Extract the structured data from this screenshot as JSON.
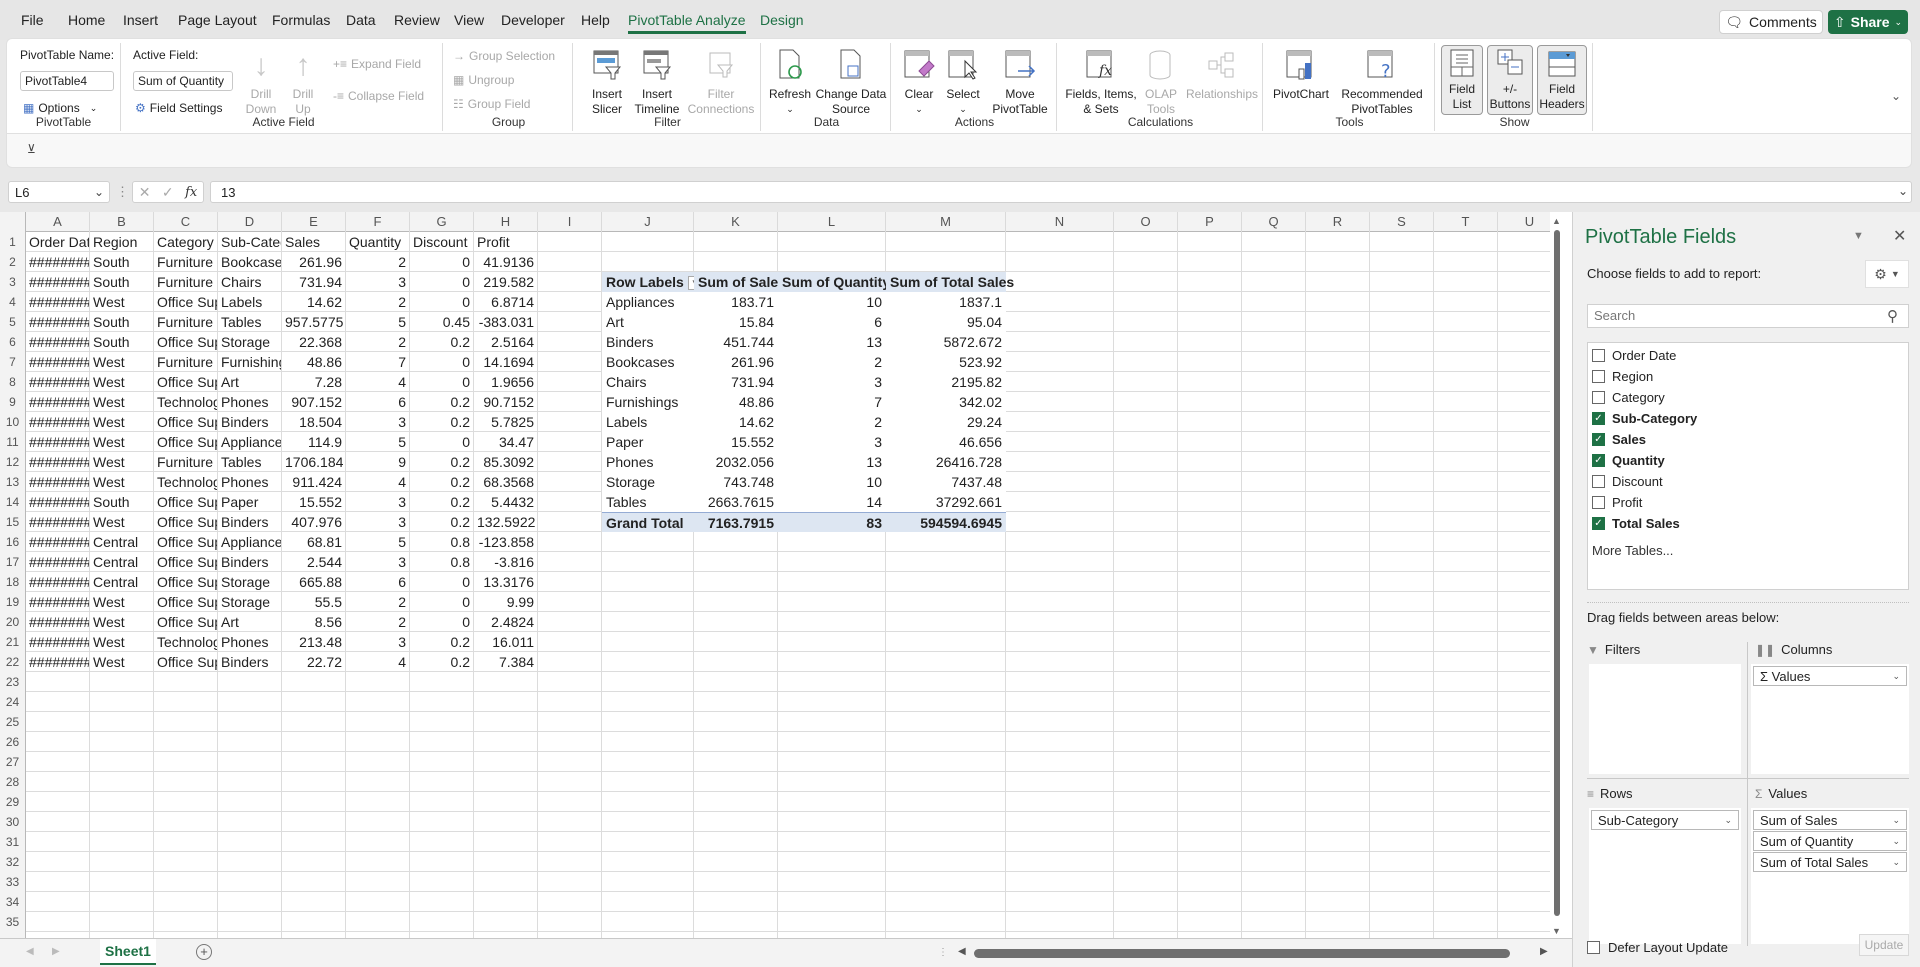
{
  "menu": {
    "items": [
      "File",
      "Home",
      "Insert",
      "Page Layout",
      "Formulas",
      "Data",
      "Review",
      "View",
      "Developer",
      "Help",
      "PivotTable Analyze",
      "Design"
    ],
    "active": "PivotTable Analyze",
    "comments_label": "Comments",
    "share_label": "Share"
  },
  "ribbon": {
    "pivottable": {
      "name_label": "PivotTable Name:",
      "name_value": "PivotTable4",
      "options_label": "Options",
      "group_label": "PivotTable"
    },
    "active_field": {
      "label": "Active Field:",
      "value": "Sum of Quantity",
      "field_settings": "Field Settings",
      "drill_down": "Drill Down",
      "drill_up": "Drill Up",
      "expand_field": "Expand Field",
      "collapse_field": "Collapse Field",
      "group_label": "Active Field"
    },
    "group": {
      "group_selection": "Group Selection",
      "ungroup": "Ungroup",
      "group_field": "Group Field",
      "group_label": "Group"
    },
    "filter": {
      "insert_slicer": "Insert Slicer",
      "insert_timeline": "Insert Timeline",
      "filter_connections": "Filter Connections",
      "group_label": "Filter"
    },
    "data": {
      "refresh": "Refresh",
      "change_data_source": "Change Data Source",
      "group_label": "Data"
    },
    "actions": {
      "clear": "Clear",
      "select": "Select",
      "move_pivottable": "Move PivotTable",
      "group_label": "Actions"
    },
    "calculations": {
      "fields_items_sets": "Fields, Items, & Sets",
      "olap_tools": "OLAP Tools",
      "relationships": "Relationships",
      "group_label": "Calculations"
    },
    "tools": {
      "pivotchart": "PivotChart",
      "recommended": "Recommended PivotTables",
      "group_label": "Tools"
    },
    "show": {
      "field_list": "Field List",
      "buttons": "+/- Buttons",
      "field_headers": "Field Headers",
      "group_label": "Show"
    }
  },
  "formula_bar": {
    "name_box": "L6",
    "formula": "13"
  },
  "sheet": {
    "columns": [
      "A",
      "B",
      "C",
      "D",
      "E",
      "F",
      "G",
      "H",
      "I",
      "J",
      "K",
      "L",
      "M",
      "N",
      "O",
      "P",
      "Q",
      "R",
      "S",
      "T",
      "U"
    ],
    "row_numbers": [
      1,
      2,
      3,
      4,
      5,
      6,
      7,
      8,
      9,
      10,
      11,
      12,
      13,
      14,
      15,
      16,
      17,
      18,
      19,
      20,
      21,
      22,
      23,
      24,
      25,
      26,
      27,
      28,
      29,
      30,
      31,
      32,
      33,
      34,
      35
    ],
    "headers": [
      "Order Dat",
      "Region",
      "Category",
      "Sub-Categ",
      "Sales",
      "Quantity",
      "Discount",
      "Profit"
    ],
    "rows": [
      [
        "########",
        "South",
        "Furniture",
        "Bookcases",
        "261.96",
        "2",
        "0",
        "41.9136"
      ],
      [
        "########",
        "South",
        "Furniture",
        "Chairs",
        "731.94",
        "3",
        "0",
        "219.582"
      ],
      [
        "########",
        "West",
        "Office Sup",
        "Labels",
        "14.62",
        "2",
        "0",
        "6.8714"
      ],
      [
        "########",
        "South",
        "Furniture",
        "Tables",
        "957.5775",
        "5",
        "0.45",
        "-383.031"
      ],
      [
        "########",
        "South",
        "Office Sup",
        "Storage",
        "22.368",
        "2",
        "0.2",
        "2.5164"
      ],
      [
        "########",
        "West",
        "Furniture",
        "Furnishing",
        "48.86",
        "7",
        "0",
        "14.1694"
      ],
      [
        "########",
        "West",
        "Office Sup",
        "Art",
        "7.28",
        "4",
        "0",
        "1.9656"
      ],
      [
        "########",
        "West",
        "Technolog",
        "Phones",
        "907.152",
        "6",
        "0.2",
        "90.7152"
      ],
      [
        "########",
        "West",
        "Office Sup",
        "Binders",
        "18.504",
        "3",
        "0.2",
        "5.7825"
      ],
      [
        "########",
        "West",
        "Office Sup",
        "Appliance",
        "114.9",
        "5",
        "0",
        "34.47"
      ],
      [
        "########",
        "West",
        "Furniture",
        "Tables",
        "1706.184",
        "9",
        "0.2",
        "85.3092"
      ],
      [
        "########",
        "West",
        "Technolog",
        "Phones",
        "911.424",
        "4",
        "0.2",
        "68.3568"
      ],
      [
        "########",
        "South",
        "Office Sup",
        "Paper",
        "15.552",
        "3",
        "0.2",
        "5.4432"
      ],
      [
        "########",
        "West",
        "Office Sup",
        "Binders",
        "407.976",
        "3",
        "0.2",
        "132.5922"
      ],
      [
        "########",
        "Central",
        "Office Sup",
        "Appliance",
        "68.81",
        "5",
        "0.8",
        "-123.858"
      ],
      [
        "########",
        "Central",
        "Office Sup",
        "Binders",
        "2.544",
        "3",
        "0.8",
        "-3.816"
      ],
      [
        "########",
        "Central",
        "Office Sup",
        "Storage",
        "665.88",
        "6",
        "0",
        "13.3176"
      ],
      [
        "########",
        "West",
        "Office Sup",
        "Storage",
        "55.5",
        "2",
        "0",
        "9.99"
      ],
      [
        "########",
        "West",
        "Office Sup",
        "Art",
        "8.56",
        "2",
        "0",
        "2.4824"
      ],
      [
        "########",
        "West",
        "Technolog",
        "Phones",
        "213.48",
        "3",
        "0.2",
        "16.011"
      ],
      [
        "########",
        "West",
        "Office Sup",
        "Binders",
        "22.72",
        "4",
        "0.2",
        "7.384"
      ]
    ],
    "tab_name": "Sheet1"
  },
  "pivot": {
    "headers": [
      "Row Labels",
      "Sum of Sales",
      "Sum of Quantity",
      "Sum of Total Sales"
    ],
    "rows": [
      [
        "Appliances",
        "183.71",
        "10",
        "1837.1"
      ],
      [
        "Art",
        "15.84",
        "6",
        "95.04"
      ],
      [
        "Binders",
        "451.744",
        "13",
        "5872.672"
      ],
      [
        "Bookcases",
        "261.96",
        "2",
        "523.92"
      ],
      [
        "Chairs",
        "731.94",
        "3",
        "2195.82"
      ],
      [
        "Furnishings",
        "48.86",
        "7",
        "342.02"
      ],
      [
        "Labels",
        "14.62",
        "2",
        "29.24"
      ],
      [
        "Paper",
        "15.552",
        "3",
        "46.656"
      ],
      [
        "Phones",
        "2032.056",
        "13",
        "26416.728"
      ],
      [
        "Storage",
        "743.748",
        "10",
        "7437.48"
      ],
      [
        "Tables",
        "2663.7615",
        "14",
        "37292.661"
      ]
    ],
    "grand_total": [
      "Grand Total",
      "7163.7915",
      "83",
      "594594.6945"
    ]
  },
  "pane": {
    "title": "PivotTable Fields",
    "subtitle": "Choose fields to add to report:",
    "search_placeholder": "Search",
    "fields": [
      {
        "name": "Order Date",
        "checked": false
      },
      {
        "name": "Region",
        "checked": false
      },
      {
        "name": "Category",
        "checked": false
      },
      {
        "name": "Sub-Category",
        "checked": true
      },
      {
        "name": "Sales",
        "checked": true
      },
      {
        "name": "Quantity",
        "checked": true
      },
      {
        "name": "Discount",
        "checked": false
      },
      {
        "name": "Profit",
        "checked": false
      },
      {
        "name": "Total Sales",
        "checked": true
      }
    ],
    "more_tables": "More Tables...",
    "drag_label": "Drag fields between areas below:",
    "areas": {
      "filters": {
        "title": "Filters",
        "items": []
      },
      "columns": {
        "title": "Columns",
        "items": [
          "Σ Values"
        ]
      },
      "rows": {
        "title": "Rows",
        "items": [
          "Sub-Category"
        ]
      },
      "values": {
        "title": "Values",
        "items": [
          "Sum of Sales",
          "Sum of Quantity",
          "Sum of Total Sales"
        ]
      }
    },
    "defer_label": "Defer Layout Update",
    "defer_checked": false,
    "update_label": "Update"
  },
  "colors": {
    "accent": "#1e7145",
    "pivot_header_bg": "#dde6f2"
  }
}
